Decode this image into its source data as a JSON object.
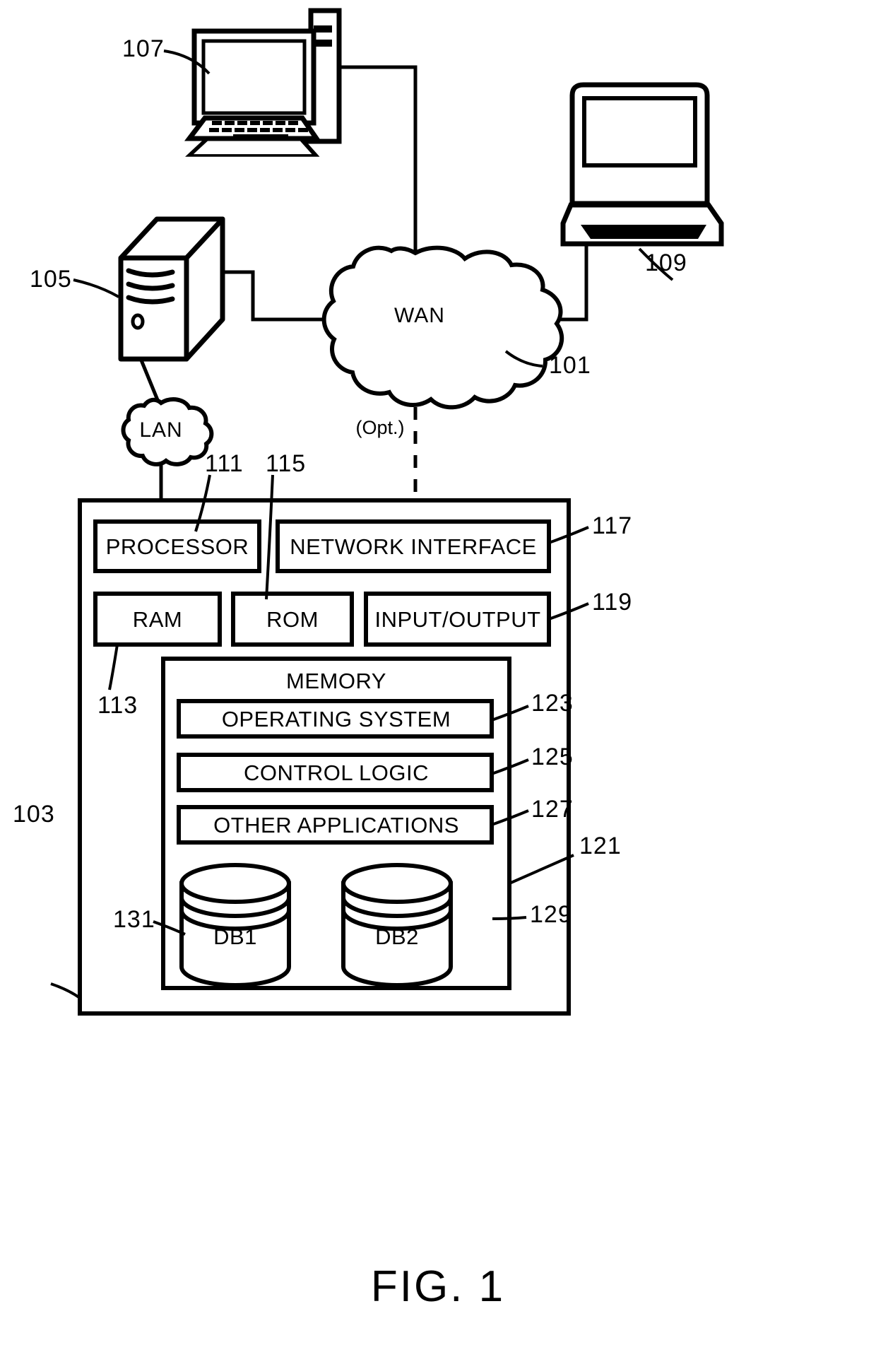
{
  "figure": {
    "caption": "FIG. 1",
    "title": "Computing device network architecture diagram"
  },
  "network": {
    "wan_label": "WAN",
    "wan_ref": "101",
    "lan_label": "LAN",
    "optional_label": "(Opt.)"
  },
  "devices": [
    {
      "name": "desktop-computer",
      "ref": "107"
    },
    {
      "name": "laptop-computer",
      "ref": "109"
    },
    {
      "name": "server-tower",
      "ref": "105"
    }
  ],
  "computing_device": {
    "ref": "103",
    "components": [
      {
        "id": "processor",
        "label": "PROCESSOR",
        "ref": "111"
      },
      {
        "id": "network-interface",
        "label": "NETWORK INTERFACE",
        "ref": "117"
      },
      {
        "id": "ram",
        "label": "RAM",
        "ref": "113"
      },
      {
        "id": "rom",
        "label": "ROM",
        "ref": "115"
      },
      {
        "id": "input-output",
        "label": "INPUT/OUTPUT",
        "ref": "119"
      }
    ],
    "memory": {
      "label": "MEMORY",
      "ref": "121",
      "items": [
        {
          "id": "operating-system",
          "label": "OPERATING SYSTEM",
          "ref": "123"
        },
        {
          "id": "control-logic",
          "label": "CONTROL LOGIC",
          "ref": "125"
        },
        {
          "id": "other-applications",
          "label": "OTHER APPLICATIONS",
          "ref": "127"
        }
      ],
      "databases": [
        {
          "id": "db1",
          "label": "DB1",
          "ref": "131"
        },
        {
          "id": "db2",
          "label": "DB2",
          "ref": "129"
        }
      ]
    }
  },
  "style": {
    "stroke": "#000000",
    "fill": "#ffffff"
  }
}
